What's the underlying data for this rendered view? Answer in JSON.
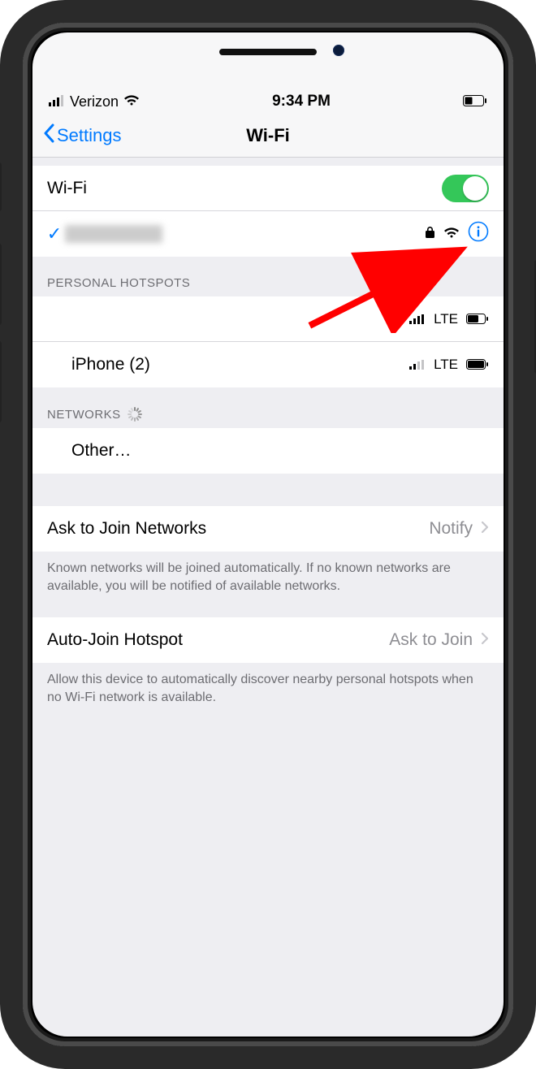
{
  "statusbar": {
    "carrier": "Verizon",
    "time": "9:34 PM"
  },
  "navbar": {
    "back_label": "Settings",
    "title": "Wi-Fi"
  },
  "wifi": {
    "toggle_label": "Wi-Fi",
    "toggle_on": true,
    "connected_network": "(redacted)"
  },
  "sections": {
    "hotspots_header": "Personal Hotspots",
    "networks_header": "Networks"
  },
  "hotspots": [
    {
      "name": "(redacted)",
      "signal_label": "LTE",
      "obscured": true,
      "battery_level": 60
    },
    {
      "name": "iPhone (2)",
      "signal_label": "LTE",
      "obscured": false,
      "battery_level": 95
    }
  ],
  "networks": {
    "other_label": "Other…"
  },
  "ask_to_join": {
    "label": "Ask to Join Networks",
    "value": "Notify",
    "footer": "Known networks will be joined automatically. If no known networks are available, you will be notified of available networks."
  },
  "auto_join": {
    "label": "Auto-Join Hotspot",
    "value": "Ask to Join",
    "footer": "Allow this device to automatically discover nearby personal hotspots when no Wi-Fi network is available."
  },
  "icons": {
    "lock": "lock-icon",
    "wifi": "wifi-icon",
    "info": "info-icon",
    "signal": "cellular-bars-icon",
    "battery": "battery-icon",
    "checkmark": "checkmark-icon",
    "chevron_left": "chevron-left-icon",
    "chevron_right": "chevron-right-icon",
    "spinner": "spinner-icon"
  }
}
